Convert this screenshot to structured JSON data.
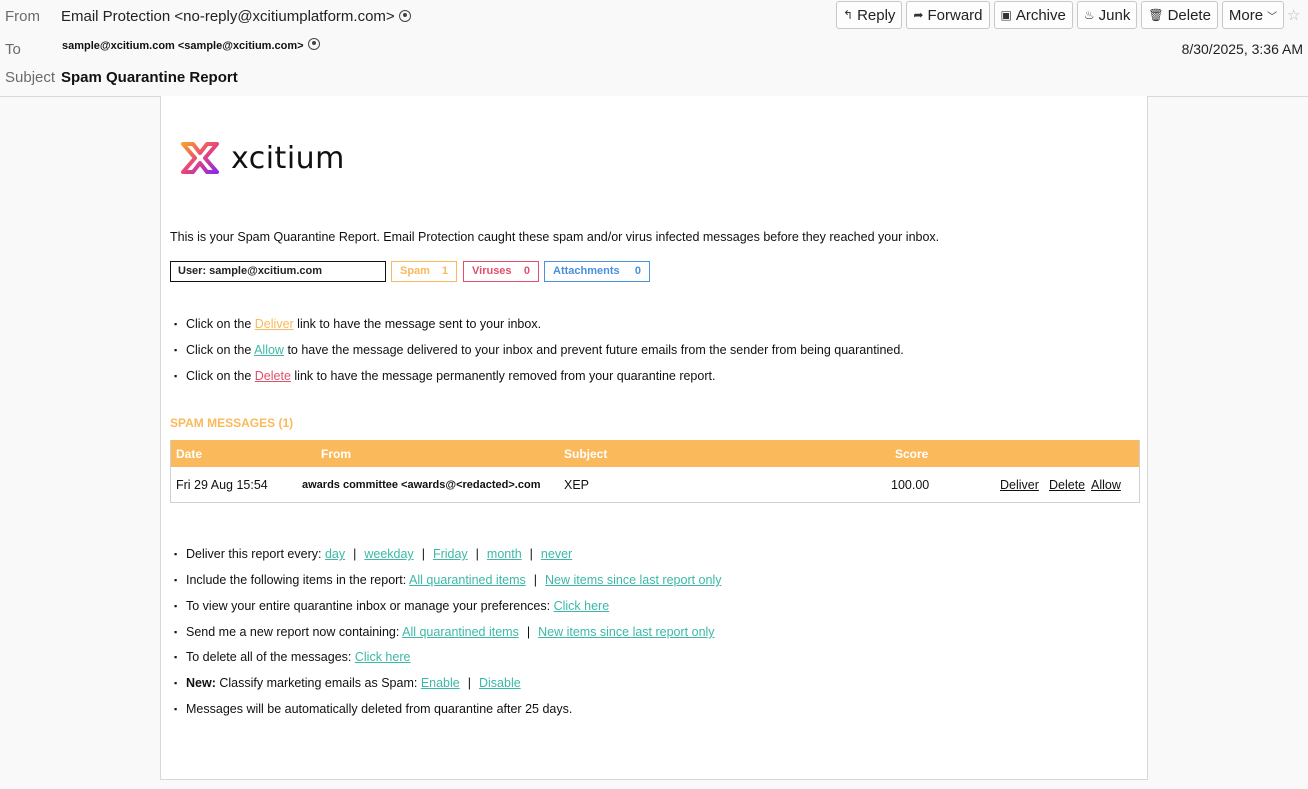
{
  "header": {
    "from_label": "From",
    "from_value": "Email Protection <no-reply@xcitiumplatform.com>",
    "to_label": "To",
    "to_value": "sample@xcitium.com <sample@xcitium.com>",
    "subject_label": "Subject",
    "subject_value": "Spam Quarantine Report",
    "date": "8/30/2025, 3:36 AM",
    "buttons": {
      "reply": "Reply",
      "forward": "Forward",
      "archive": "Archive",
      "junk": "Junk",
      "delete": "Delete",
      "more": "More"
    }
  },
  "email": {
    "logo_text": "xcitium",
    "intro": "This is your Spam Quarantine Report. Email Protection caught these spam and/or virus infected messages before they reached your inbox.",
    "user": "User: sample@xcitium.com",
    "counts": {
      "spam_label": "Spam",
      "spam_value": "1",
      "viruses_label": "Viruses",
      "viruses_value": "0",
      "attachments_label": "Attachments",
      "attachments_value": "0"
    },
    "instructions": [
      {
        "pre": "Click on the ",
        "link": "Deliver",
        "post": " link to have the message sent to your inbox."
      },
      {
        "pre": "Click on the ",
        "link": "Allow",
        "post": " to have the message delivered to your inbox and prevent future emails from the sender from being quarantined."
      },
      {
        "pre": "Click on the ",
        "link": "Delete",
        "post": " link to have the message permanently removed from your quarantine report."
      }
    ],
    "section_title": "SPAM MESSAGES (1)",
    "table": {
      "headers": {
        "date": "Date",
        "from": "From",
        "subject": "Subject",
        "score": "Score"
      },
      "rows": [
        {
          "date": "Fri 29 Aug 15:54",
          "from": "awards committee <awards@<redacted>.com",
          "subject": "XEP",
          "score": "100.00",
          "deliver": "Deliver",
          "delete": "Delete",
          "allow": "Allow"
        }
      ]
    },
    "options": {
      "frequency_label": "Deliver this report every: ",
      "frequency": [
        "day",
        "weekday",
        "Friday",
        "month",
        "never"
      ],
      "include_label": "Include the following items in the report: ",
      "include_all": "All quarantined items",
      "include_new": "New items since last report only",
      "view_label": "To view your entire quarantine inbox or manage your preferences: ",
      "view_link": "Click here",
      "send_label": "Send me a new report now containing: ",
      "send_all": "All quarantined items",
      "send_new": "New items since last report only",
      "delete_all_label": "To delete all of the messages: ",
      "delete_all_link": "Click here",
      "new_label": "New:",
      "classify_label": " Classify marketing emails as Spam: ",
      "enable": "Enable",
      "disable": "Disable",
      "auto_delete": "Messages will be automatically deleted from quarantine after 25 days.",
      "separator": "|"
    }
  },
  "colors": {
    "orange": "#fab95b",
    "red": "#e0506a",
    "blue": "#4a8fe0",
    "green": "#3bb9a6"
  },
  "icons": [
    "person-icon",
    "reply-icon",
    "forward-icon",
    "archive-icon",
    "junk-icon",
    "trash-icon",
    "chevron-down-icon",
    "star-icon",
    "xcitium-logo-icon"
  ]
}
